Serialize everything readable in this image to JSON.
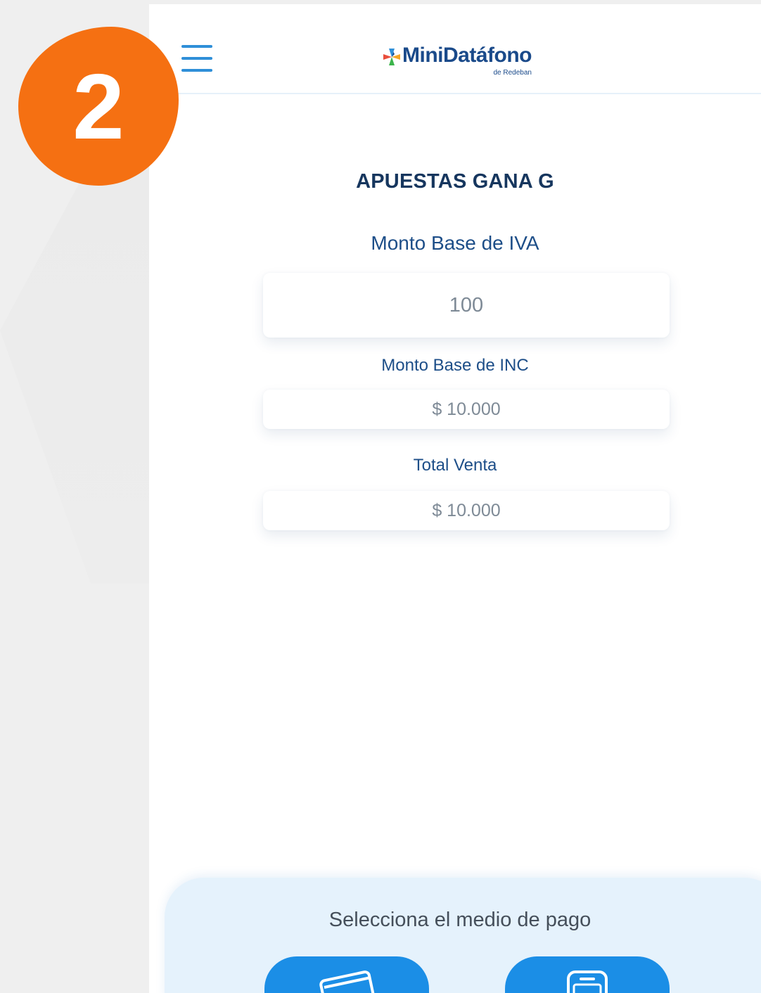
{
  "step_badge": {
    "number": "2",
    "color": "#f57012"
  },
  "header": {
    "logo_text": "MiniDatáfono",
    "logo_subtext": "de Redeban",
    "menu_icon": "hamburger-menu-icon"
  },
  "transaction": {
    "merchant_name": "APUESTAS GANA G",
    "fields": [
      {
        "label": "Monto Base de IVA",
        "value": "100"
      },
      {
        "label": "Monto Base de INC",
        "value": "$ 10.000"
      },
      {
        "label": "Total Venta",
        "value": "$ 10.000"
      }
    ]
  },
  "payment": {
    "title": "Selecciona el medio de pago",
    "options": [
      {
        "icon": "card-icon"
      },
      {
        "icon": "pos-terminal-icon"
      }
    ]
  },
  "colors": {
    "accent_blue": "#1b8ee6",
    "dark_navy": "#16365e",
    "label_blue": "#1d4e88",
    "panel_bg": "#e5f2fc"
  }
}
